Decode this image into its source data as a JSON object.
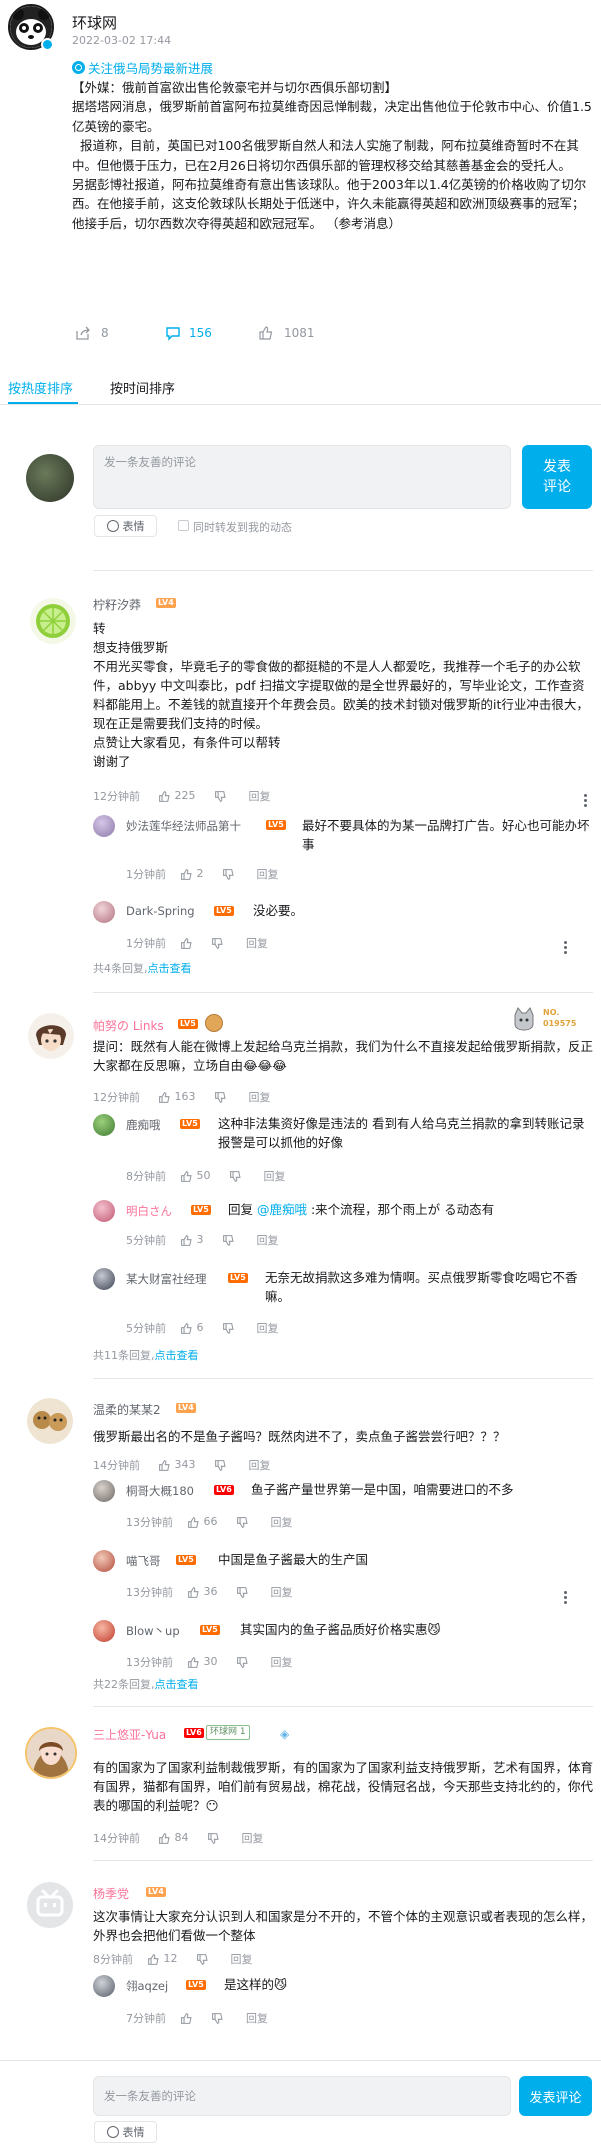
{
  "post": {
    "author": "环球网",
    "time": "2022-03-02 17:44",
    "topic_link": "关注俄乌局势最新进展",
    "body": "【外媒：俄前首富欲出售伦敦豪宅并与切尔西俱乐部切割】\n据塔塔网消息，俄罗斯前首富阿布拉莫维奇因忌惮制裁，决定出售他位于伦敦市中心、价值1.5亿英镑的豪宅。\n  报道称，目前，英国已对100名俄罗斯自然人和法人实施了制裁，阿布拉莫维奇暂时不在其中。但他慑于压力，已在2月26日将切尔西俱乐部的管理权移交给其慈善基金会的受托人。\n另据彭博社报道，阿布拉莫维奇有意出售该球队。他于2003年以1.4亿英镑的价格收购了切尔西。在他接手前，这支伦敦球队长期处于低迷中，许久未能赢得英超和欧洲顶级赛事的冠军；他接手后，切尔西数次夺得英超和欧冠冠军。 （参考消息）",
    "share_count": "8",
    "comment_count": "156",
    "like_count": "1081"
  },
  "tabs": [
    "按热度排序",
    "按时间排序"
  ],
  "composer": {
    "placeholder": "发一条友善的评论",
    "submit_label": "发表\n评论",
    "emoji_label": "表情",
    "sync_label": "同时转发到我的动态"
  },
  "comments": [
    {
      "user": "柠籽汐莽",
      "level": "LV4",
      "text": "转\n想支持俄罗斯\n不用光买零食，毕竟毛子的零食做的都挺糙的不是人人都爱吃，我推荐一个毛子的办公软件，abbyy 中文叫泰比，pdf 扫描文字提取做的是全世界最好的，写毕业论文，工作查资料都能用上。不差钱的就直接开个年费会员。欧美的技术封锁对俄罗斯的it行业冲击很大，现在正是需要我们支持的时候。\n点赞让大家看见，有条件可以帮转\n谢谢了",
      "time": "12分钟前",
      "likes": "225",
      "reply_label": "回复",
      "replies": [
        {
          "user": "妙法莲华经法师品第十",
          "level": "LV5",
          "text": "最好不要具体的为某一品牌打广告。好心也可能办坏事",
          "time": "1分钟前",
          "likes": "2"
        },
        {
          "user": "Dark-Spring",
          "level": "LV5",
          "text": "没必要。",
          "time": "1分钟前",
          "likes": ""
        }
      ],
      "more_prefix": "共4条回复,",
      "more_link": "点击查看"
    },
    {
      "user": "帕努の Links",
      "level": "LV5",
      "badge_no": "NO.\n019575",
      "text": "提问：既然有人能在微博上发起给乌克兰捐款，我们为什么不直接发起给俄罗斯捐款，反正大家都在反思嘛，立场自由😂😂😂",
      "time": "12分钟前",
      "likes": "163",
      "reply_label": "回复",
      "replies": [
        {
          "user": "鹿痴哦",
          "level": "LV5",
          "text": "这种非法集资好像是违法的   看到有人给乌克兰捐款的拿到转账记录报警是可以抓他的好像",
          "time": "8分钟前",
          "likes": "50"
        },
        {
          "user": "明白さん",
          "level": "LV5",
          "text_prefix": "回复 ",
          "mention": "@鹿痴哦",
          "text": " :来个流程，那个雨上が る动态有",
          "time": "5分钟前",
          "likes": "3"
        },
        {
          "user": "某大财富社经理",
          "level": "LV5",
          "text": "无奈无故捐款这多难为情啊。买点俄罗斯零食吃喝它不香嘛。",
          "time": "5分钟前",
          "likes": "6"
        }
      ],
      "more_prefix": "共11条回复,",
      "more_link": "点击查看"
    },
    {
      "user": "温柔的某某2",
      "level": "LV4",
      "text": "俄罗斯最出名的不是鱼子酱吗？既然肉进不了，卖点鱼子酱尝尝行吧？？？",
      "time": "14分钟前",
      "likes": "343",
      "reply_label": "回复",
      "replies": [
        {
          "user": "桐哥大概180",
          "level": "LV6",
          "text": "鱼子酱产量世界第一是中国，咱需要进口的不多",
          "time": "13分钟前",
          "likes": "66"
        },
        {
          "user": "喵飞哥",
          "level": "LV5",
          "text": "中国是鱼子酱最大的生产国",
          "time": "13分钟前",
          "likes": "36"
        },
        {
          "user": "Blow丶up",
          "level": "LV5",
          "text": "其实国内的鱼子酱品质好价格实惠😼",
          "time": "13分钟前",
          "likes": "30"
        }
      ],
      "more_prefix": "共22条回复,",
      "more_link": "点击查看"
    },
    {
      "user": "三上悠亚-Yua",
      "level": "LV6",
      "fan_badge": "环球网 1",
      "text": "有的国家为了国家利益制裁俄罗斯，有的国家为了国家利益支持俄罗斯，艺术有国界，体育有国界，猫都有国界，咱们前有贸易战，棉花战，役情冠名战，今天那些支持北约的，你代表的哪国的利益呢？😶",
      "time": "14分钟前",
      "likes": "84",
      "reply_label": "回复",
      "replies": []
    },
    {
      "user": "杨季党",
      "level": "LV4",
      "text": "这次事情让大家充分认识到人和国家是分不开的，不管个体的主观意识或者表现的怎么样，外界也会把他们看做一个整体",
      "time": "8分钟前",
      "likes": "12",
      "reply_label": "回复",
      "replies": [
        {
          "user": "翎aqzej",
          "level": "LV5",
          "text": "是这样的😼",
          "time": "7分钟前",
          "likes": ""
        }
      ]
    }
  ],
  "bottom_composer": {
    "placeholder": "发一条友善的评论",
    "submit_label": "发表评论",
    "emoji_label": "表情"
  },
  "colors": {
    "accent": "#00aeec",
    "text": "#18191c",
    "muted": "#9499a0",
    "lv4": "#ffa24e",
    "lv5": "#ff6c00",
    "lv6": "#ff0000"
  }
}
